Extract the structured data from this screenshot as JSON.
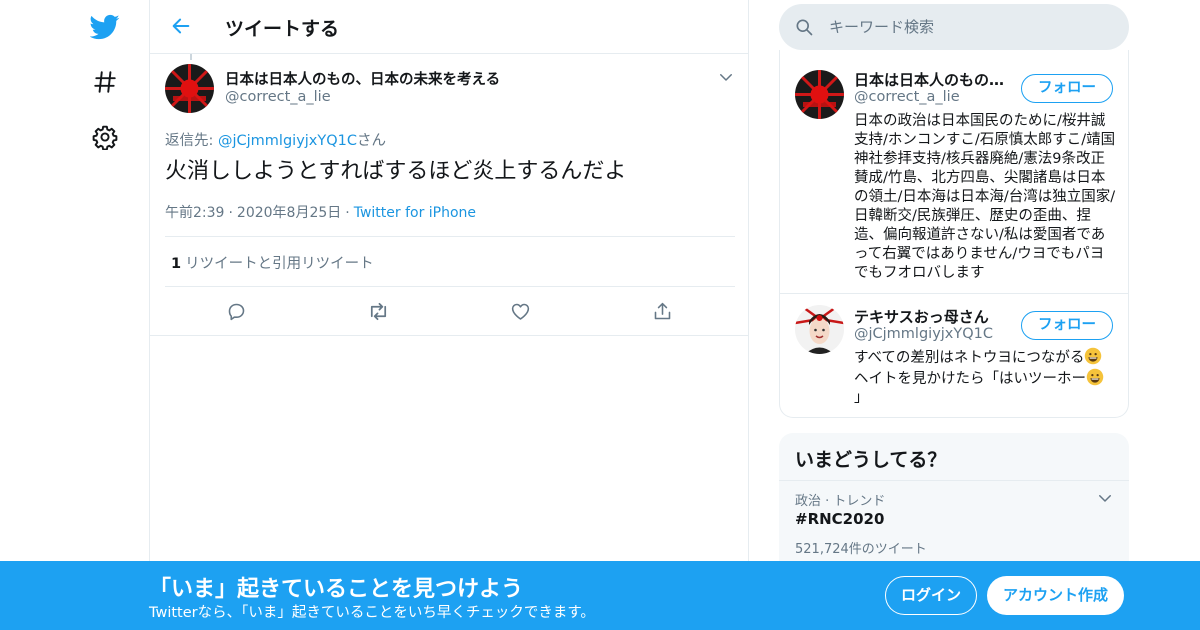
{
  "colors": {
    "accent": "#1da1f2",
    "link": "#1b95e0",
    "text": "#14171a",
    "secondary": "#657786",
    "border": "#e6ecf0"
  },
  "nav": {
    "icons": [
      "twitter-bird-icon",
      "hashtag-icon",
      "gear-icon"
    ]
  },
  "header": {
    "title": "ツイートする"
  },
  "tweet": {
    "author_name": "日本は日本人のもの、日本の未来を考える",
    "author_handle": "@correct_a_lie",
    "reply_prefix": "返信先: ",
    "reply_to": "@jCjmmlgiyjxYQ1C",
    "reply_suffix": "さん",
    "text": "火消ししようとすればするほど炎上するんだよ",
    "time": "午前2:39",
    "date": "2020年8月25日",
    "source": "Twitter for iPhone",
    "retweet_count": "1",
    "retweet_label": "リツイートと引用リツイート"
  },
  "search": {
    "placeholder": "キーワード検索"
  },
  "who_to_follow": [
    {
      "name": "日本は日本人のもの…",
      "handle": "@correct_a_lie",
      "follow_label": "フォロー",
      "bio": "日本の政治は日本国民のために/桜井誠支持/ホンコンすこ/石原慎太郎すこ/靖国神社参拝支持/核兵器廃絶/憲法9条改正賛成/竹島、北方四島、尖閣諸島は日本の領土/日本海は日本海/台湾は独立国家/日韓断交/民族弾圧、歴史の歪曲、捏造、偏向報道許さない/私は愛国者であって右翼ではありません/ウヨでもパヨでもフオロバします"
    },
    {
      "name": "テキサスおっ母さん",
      "handle": "@jCjmmlgiyjxYQ1C",
      "follow_label": "フォロー",
      "bio_part1": "すべての差別はネトウヨにつながる",
      "bio_part2": "ヘイトを見かけたら「はいツーホー",
      "bio_part3": "」"
    }
  ],
  "trends": {
    "title": "いまどうしてる？",
    "items": [
      {
        "category": "政治 · トレンド",
        "tag": "#RNC2020",
        "count": "521,724件のツイート"
      }
    ]
  },
  "banner": {
    "title": "「いま」起きていることを見つけよう",
    "subtitle": "Twitterなら、「いま」起きていることをいち早くチェックできます。",
    "login_label": "ログイン",
    "signup_label": "アカウント作成"
  }
}
